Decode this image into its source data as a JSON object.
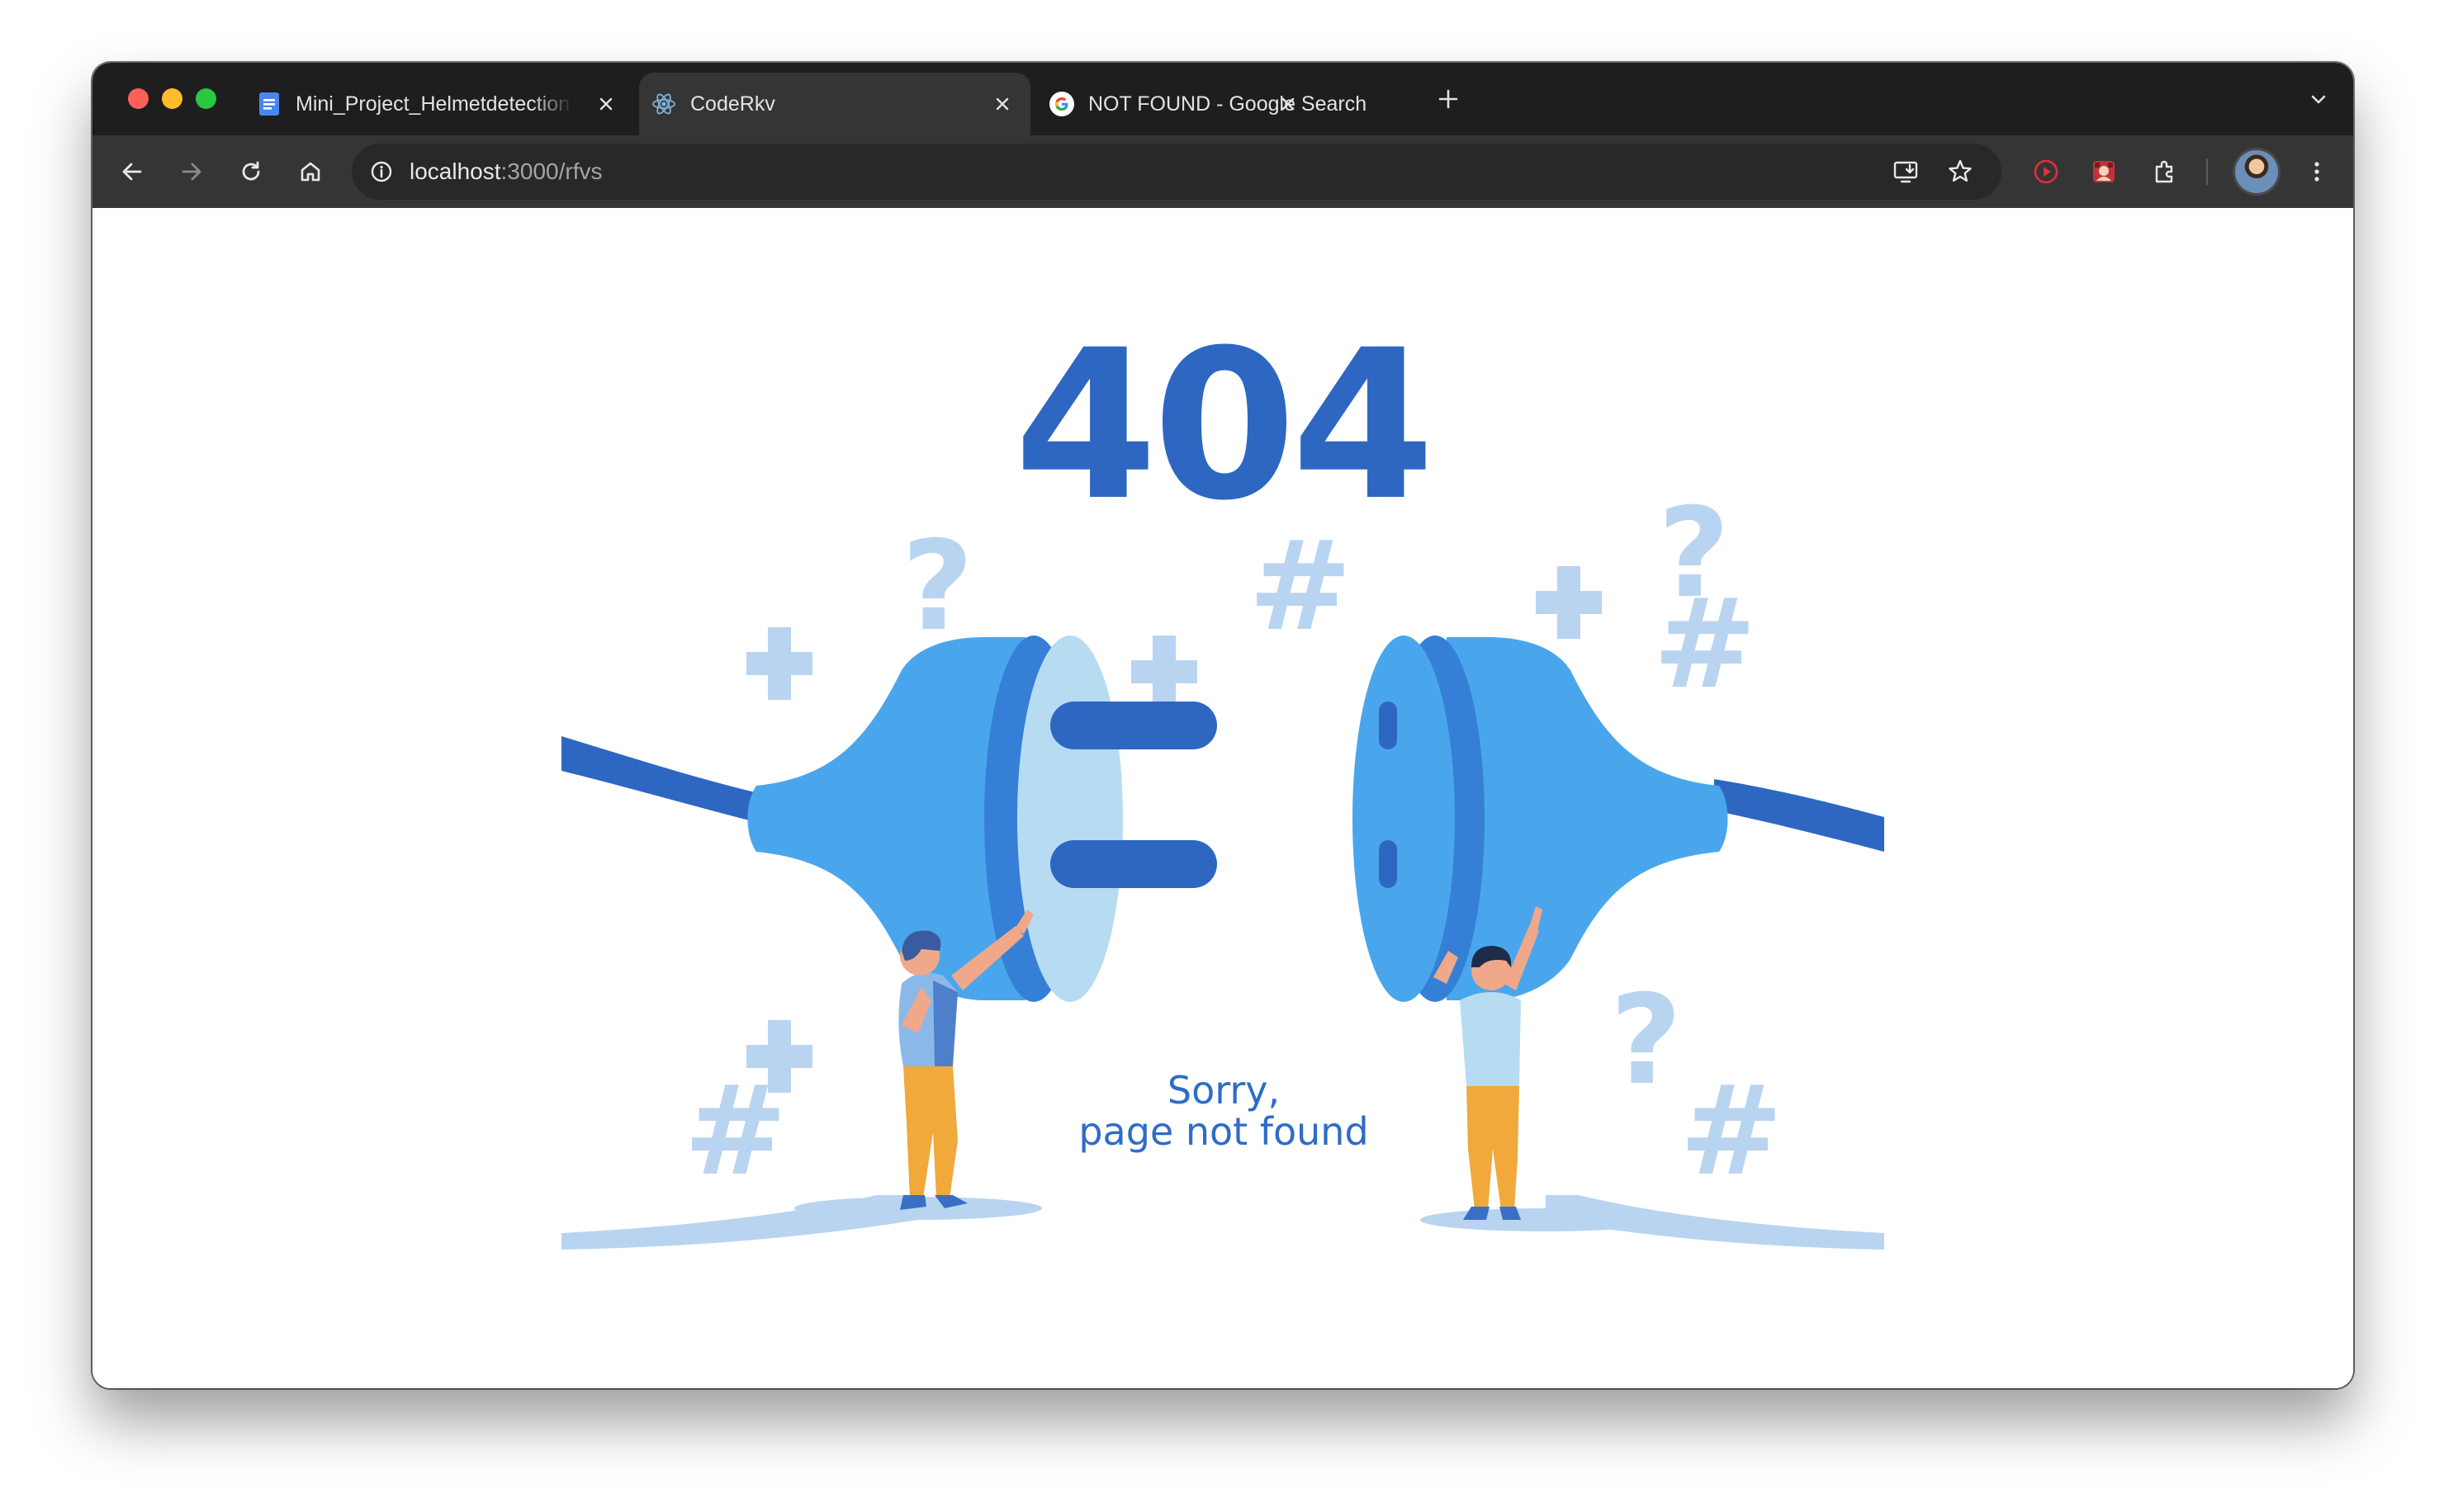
{
  "browser": {
    "tabs": [
      {
        "title": "Mini_Project_Helmetdetection",
        "icon": "google-docs-icon",
        "active": false
      },
      {
        "title": "CodeRkv",
        "icon": "react-icon",
        "active": true
      },
      {
        "title": "NOT FOUND - Google Search",
        "icon": "google-icon",
        "active": false
      }
    ],
    "address": {
      "host": "localhost",
      "path": ":3000/rfvs"
    }
  },
  "page": {
    "error_code": "404",
    "message_line1": "Sorry,",
    "message_line2": "page not found"
  },
  "colors": {
    "primary_blue": "#2e67c2",
    "plug_blue": "#4aa6ec",
    "light_blue": "#b7dcf2",
    "pale_blue": "#bcd7f3",
    "pants_orange": "#f0a93a"
  }
}
